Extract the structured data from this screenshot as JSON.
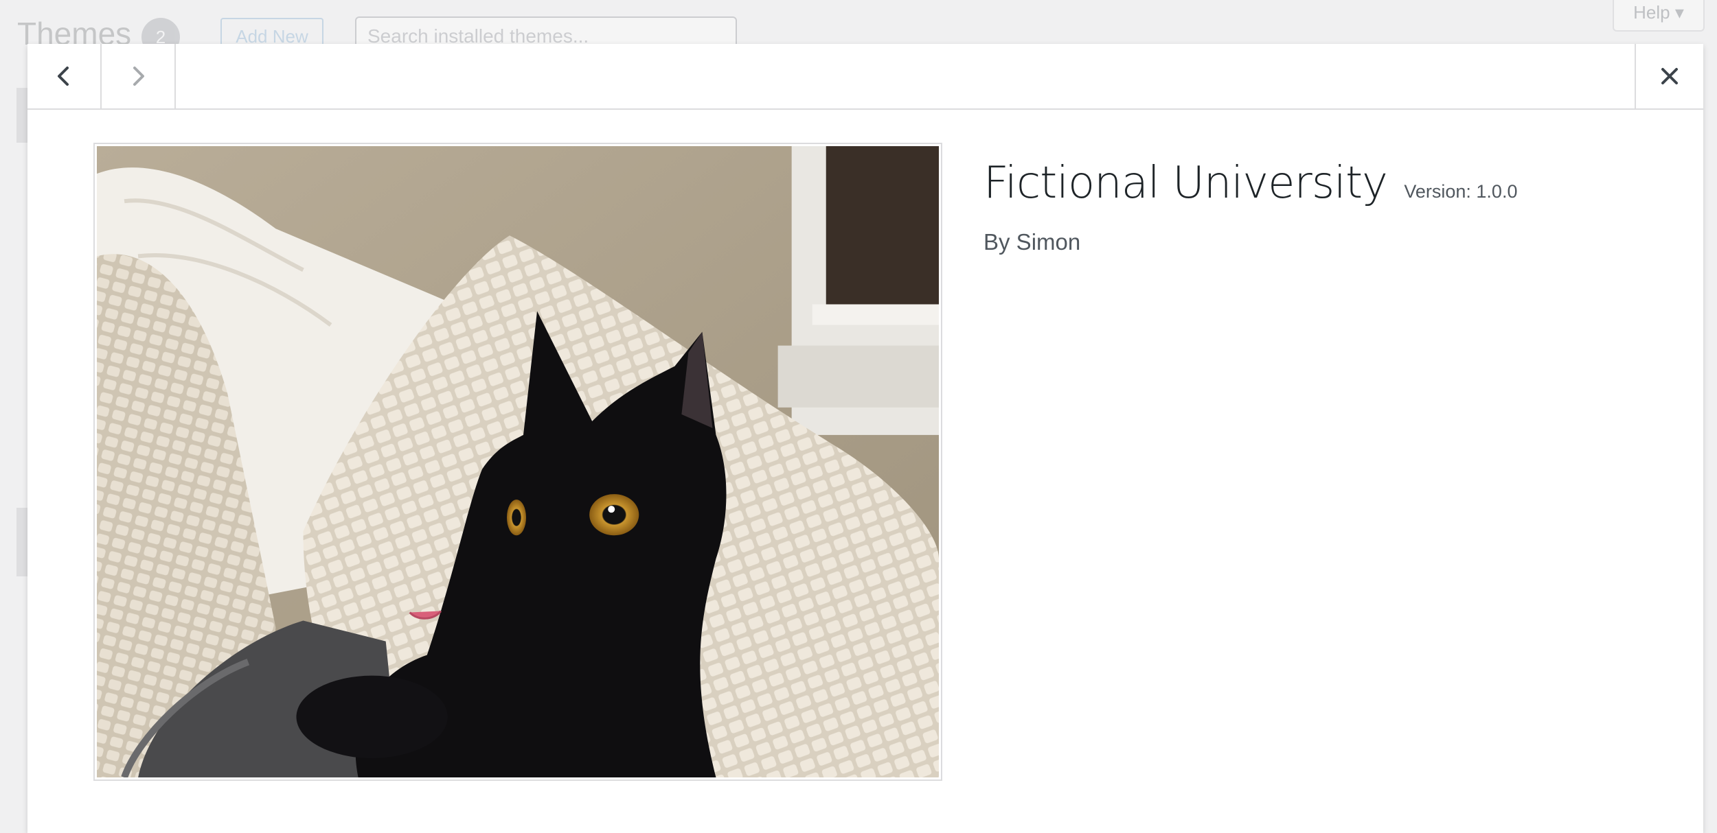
{
  "background": {
    "title": "Themes",
    "count": "2",
    "add_new_label": "Add New",
    "search_placeholder": "Search installed themes...",
    "help_label": "Help ▾"
  },
  "overlay": {
    "prev_icon": "chevron-left-icon",
    "next_icon": "chevron-right-icon",
    "close_icon": "close-icon",
    "prev_enabled": true,
    "next_enabled": false,
    "screenshot_alt": "Theme screenshot",
    "theme": {
      "name": "Fictional University",
      "version_label": "Version: 1.0.0",
      "author": "By Simon"
    }
  },
  "colors": {
    "text_dark": "#1d2327",
    "text_muted": "#50575e",
    "border": "#dcdcde",
    "icon_active": "#50575e",
    "icon_disabled": "#a7aaad"
  }
}
